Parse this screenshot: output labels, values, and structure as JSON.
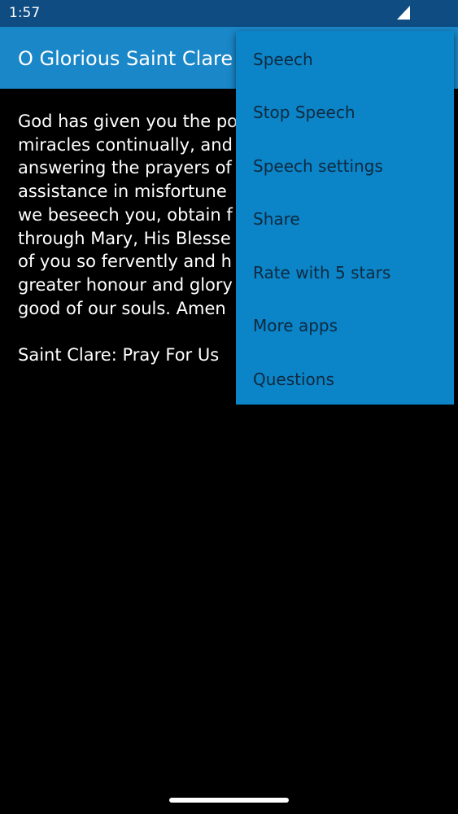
{
  "status_bar": {
    "time": "1:57",
    "signal_icon": "signal-icon"
  },
  "app_bar": {
    "title": "O Glorious Saint Clare"
  },
  "content": {
    "text": "God has given you the po\nmiracles continually, and\nanswering the prayers of\nassistance in misfortune\nwe beseech you, obtain f\nthrough Mary, His Blesse\nof you so fervently and h\ngreater honour and glory\ngood of our souls. Amen\n\nSaint Clare: Pray For Us"
  },
  "menu": {
    "items": [
      {
        "label": "Speech"
      },
      {
        "label": "Stop Speech"
      },
      {
        "label": "Speech settings"
      },
      {
        "label": "Share"
      },
      {
        "label": "Rate with 5 stars"
      },
      {
        "label": "More apps"
      },
      {
        "label": "Questions"
      }
    ]
  },
  "colors": {
    "status_bar": "#0f4c82",
    "app_bar": "#1a87c9",
    "menu_background": "#0b84c8",
    "menu_text": "#0e2a3f",
    "content_background": "#000000"
  }
}
